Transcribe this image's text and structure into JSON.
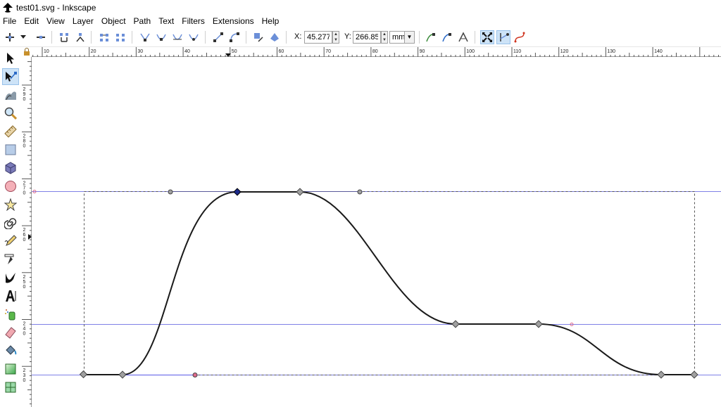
{
  "window": {
    "title": "test01.svg - Inkscape"
  },
  "menu": [
    "File",
    "Edit",
    "View",
    "Layer",
    "Object",
    "Path",
    "Text",
    "Filters",
    "Extensions",
    "Help"
  ],
  "toolbar": {
    "x_label": "X:",
    "x_value": "45.277",
    "y_label": "Y:",
    "y_value": "266.851",
    "unit": "mm"
  },
  "ruler": {
    "top_labels": [
      "10",
      "20",
      "30",
      "40",
      "50",
      "60",
      "70",
      "80",
      "90",
      "100",
      "110",
      "120",
      "130",
      "140"
    ],
    "left_labels": [
      "290",
      "280",
      "270",
      "260",
      "250",
      "240",
      "230"
    ]
  },
  "colors": {
    "accent": "#cde3f7",
    "guide": "#7f80e6",
    "path": "#1a1a1a",
    "node": "#a0a0a0",
    "selected_node": "#1b2a8a"
  }
}
